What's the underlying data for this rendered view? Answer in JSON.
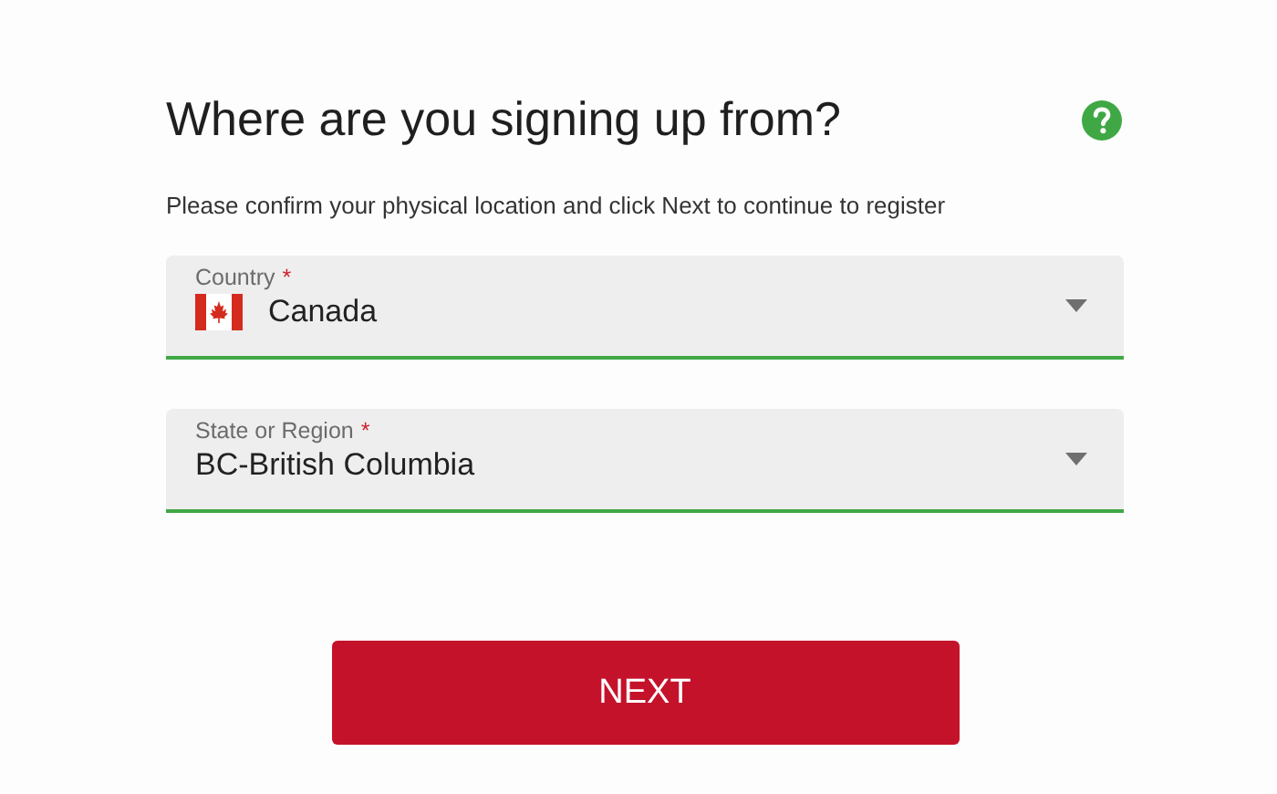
{
  "title": "Where are you signing up from?",
  "subtitle": "Please confirm your physical location and click Next to continue to register",
  "fields": [
    {
      "kind": "flag-select",
      "label": "Country",
      "required_mark": "*",
      "value": "Canada"
    },
    {
      "kind": "select",
      "label": "State or Region",
      "required_mark": "*",
      "value": "BC-British Columbia"
    }
  ],
  "button": "NEXT"
}
